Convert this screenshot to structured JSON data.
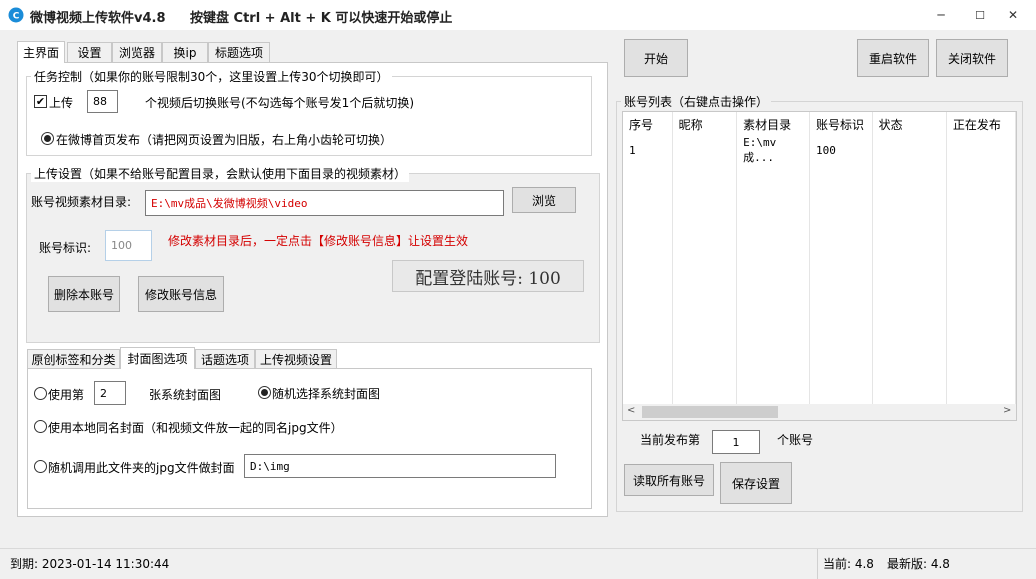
{
  "window": {
    "title": "微博视频上传软件v4.8",
    "hotkey_hint": "按键盘 Ctrl + Alt + K  可以快速开始或停止",
    "minimize": "─",
    "maximize": "☐",
    "close": "✕"
  },
  "main_tabs": [
    {
      "label": "主界面",
      "active": true
    },
    {
      "label": "设置"
    },
    {
      "label": "浏览器"
    },
    {
      "label": "换ip"
    },
    {
      "label": "标题选项"
    }
  ],
  "task_group": {
    "title": "任务控制（如果你的账号限制30个，这里设置上传30个切换即可）",
    "upload_checkbox_label": "上传",
    "upload_checked": true,
    "upload_count": "88",
    "switch_text": "个视频后切换账号(不勾选每个账号发1个后就切换)",
    "publish_radio_label": "在微博首页发布（请把网页设置为旧版，右上角小齿轮可切换）"
  },
  "upload_group": {
    "title": "上传设置（如果不给账号配置目录，会默认使用下面目录的视频素材）",
    "dir_label": "账号视频素材目录:",
    "dir_value": "E:\\mv成品\\发微博视频\\video",
    "browse_button": "浏览",
    "account_id_label": "账号标识:",
    "account_id_value": "100",
    "warning": "修改素材目录后，一定点击【修改账号信息】让设置生效",
    "delete_button": "删除本账号",
    "modify_button": "修改账号信息",
    "config_account": "配置登陆账号: 100"
  },
  "sub_tabs": [
    {
      "label": "原创标签和分类"
    },
    {
      "label": "封面图选项",
      "active": true
    },
    {
      "label": "话题选项"
    },
    {
      "label": "上传视频设置"
    }
  ],
  "cover": {
    "use_nth_label": "使用第",
    "use_nth_value": "2",
    "use_nth_suffix": "张系统封面图",
    "random_system_label": "随机选择系统封面图",
    "local_same_name_label": "使用本地同名封面（和视频文件放一起的同名jpg文件）",
    "random_folder_label": "随机调用此文件夹的jpg文件做封面",
    "folder_value": "D:\\img"
  },
  "right": {
    "start_button": "开始",
    "restart_button": "重启软件",
    "close_button": "关闭软件",
    "account_list_title": "账号列表（右键点击操作）",
    "columns": [
      "序号",
      "昵称",
      "素材目录",
      "账号标识",
      "状态",
      "正在发布"
    ],
    "rows": [
      [
        "1",
        "",
        "E:\\mv成...",
        "100",
        "",
        ""
      ]
    ],
    "current_publish_label": "当前发布第",
    "current_publish_value": "1",
    "current_publish_suffix": "个账号",
    "read_all_button": "读取所有账号",
    "save_button": "保存设置"
  },
  "status": {
    "expire": "到期:  2023-01-14 11:30:44",
    "current": "当前: 4.8",
    "latest": "最新版: 4.8"
  }
}
